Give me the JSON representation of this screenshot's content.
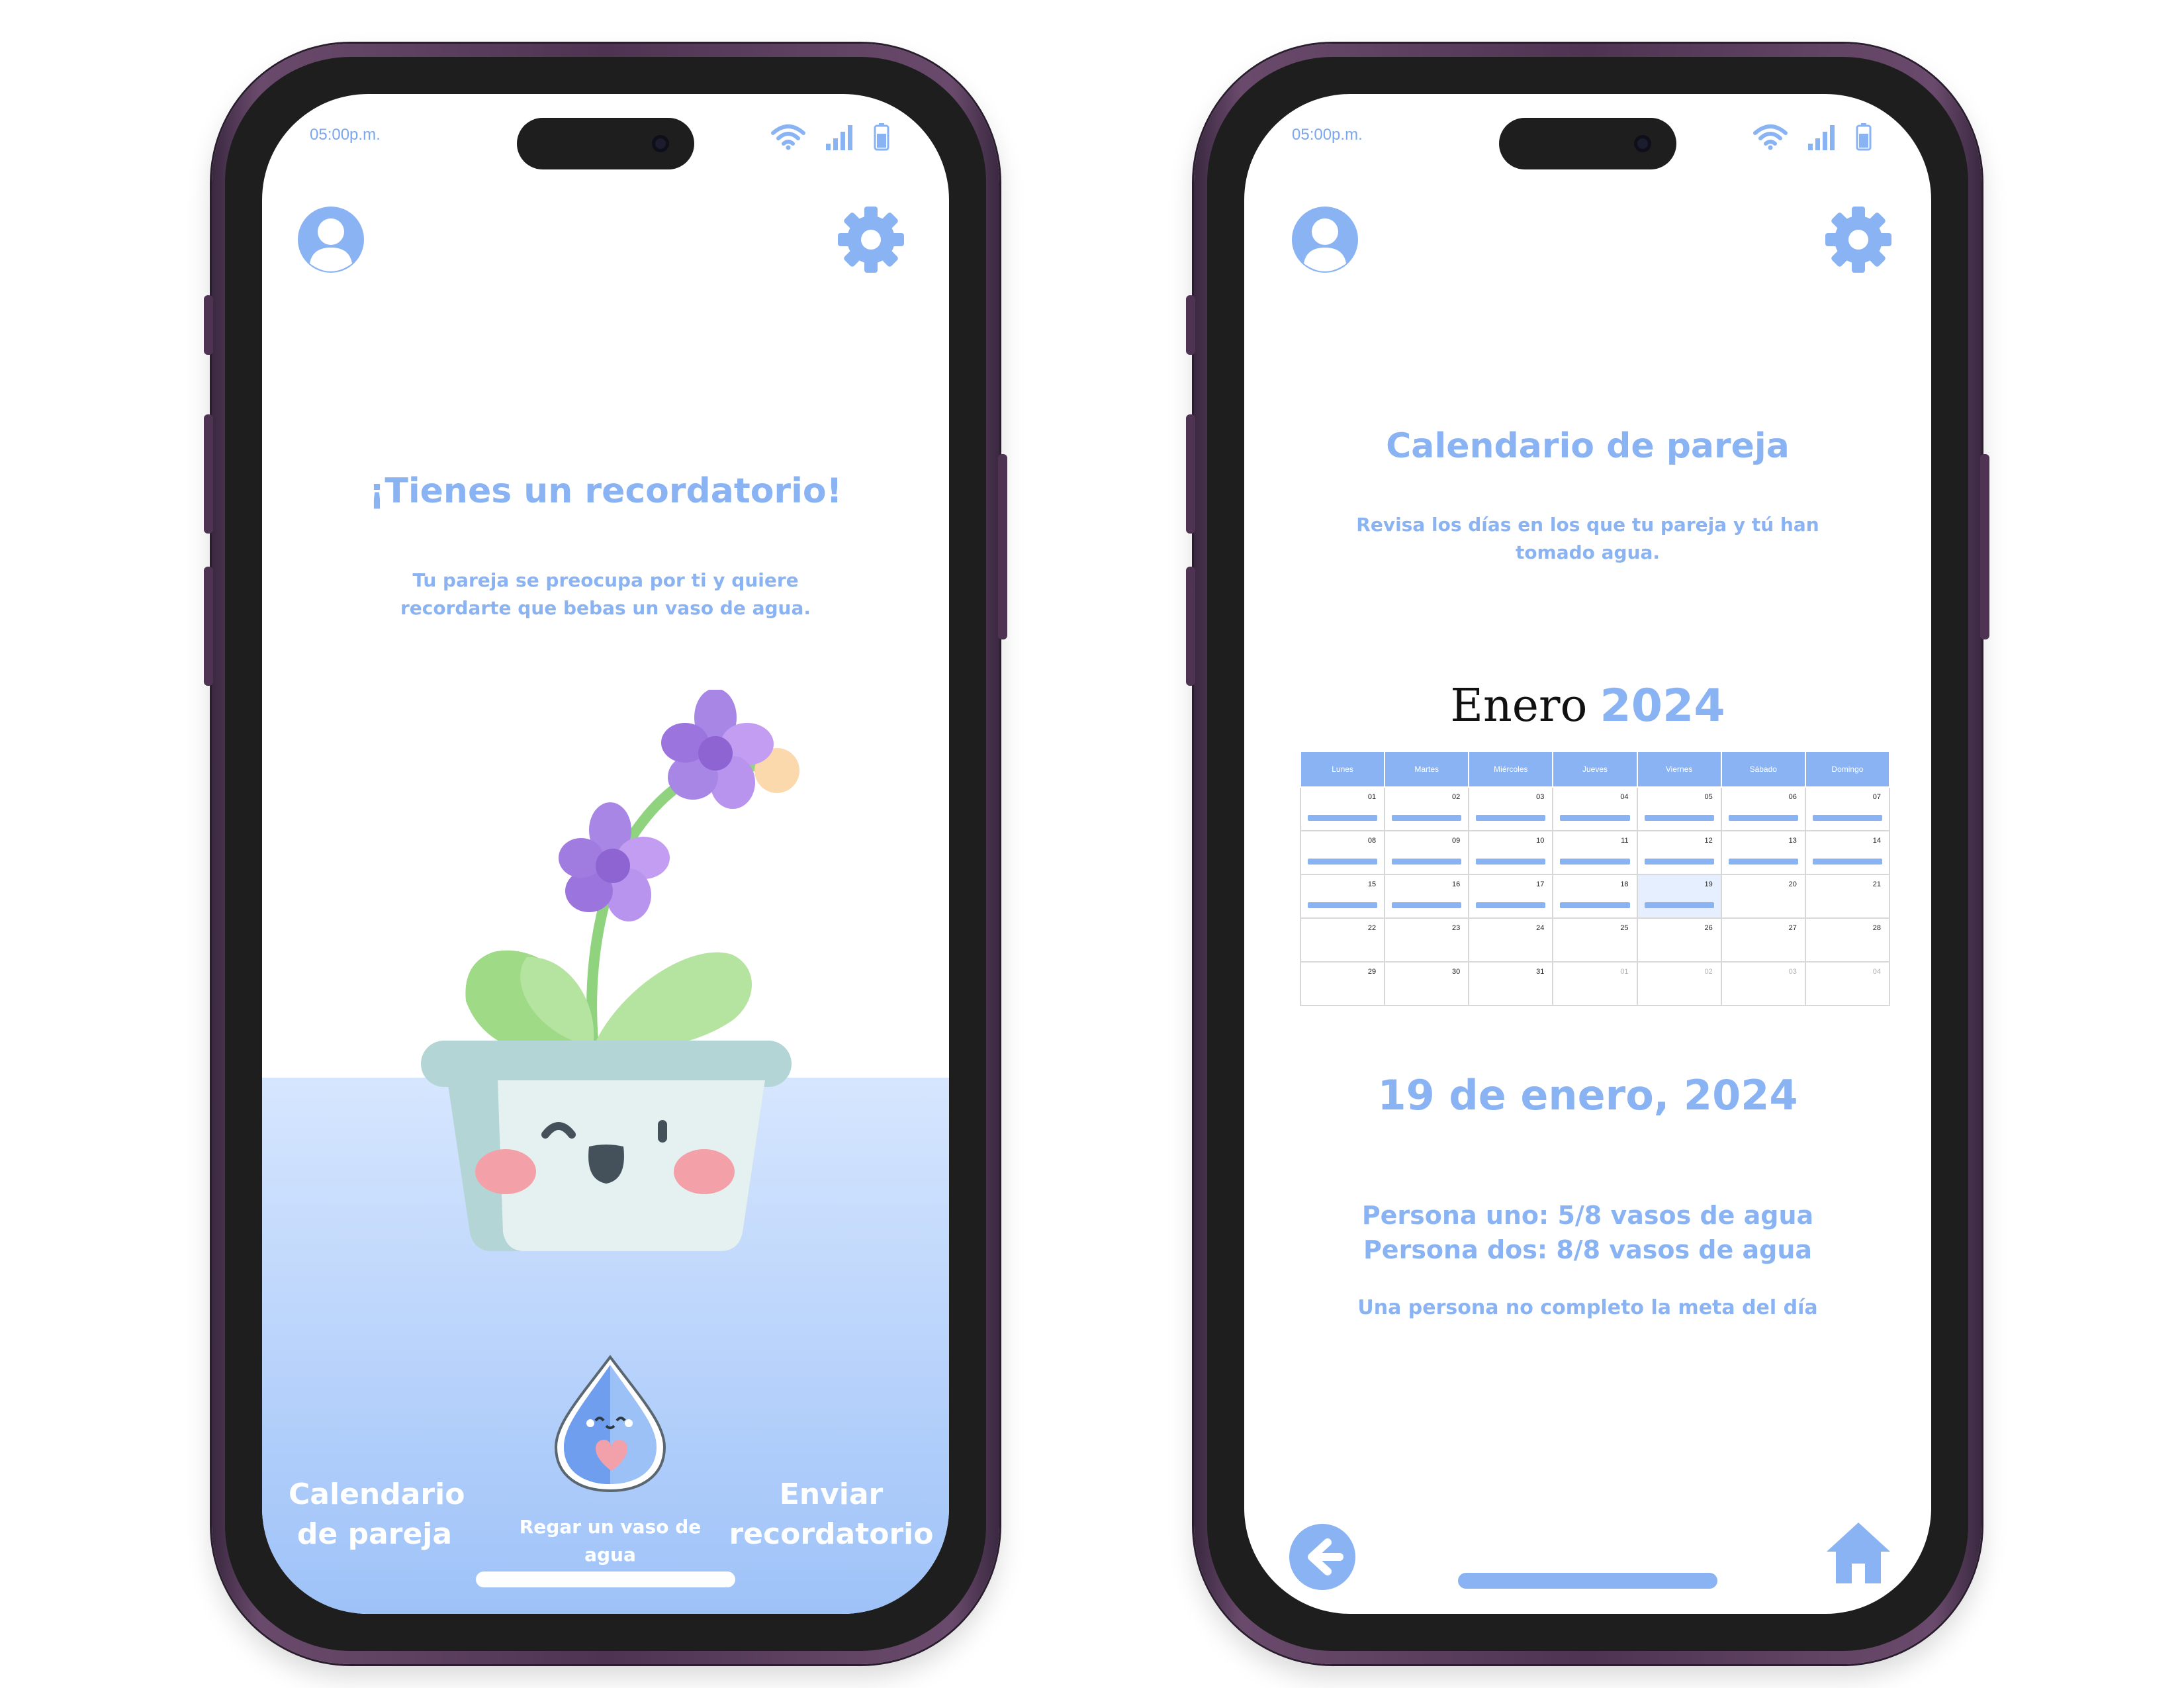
{
  "status": {
    "time": "05:00p.m."
  },
  "colors": {
    "accent": "#8ab3f3",
    "water_top": "#d6e6fe",
    "water_bottom": "#9ec2f8",
    "frame": "#4e3452"
  },
  "icons": {
    "profile": "user-circle-icon",
    "settings": "gear-icon",
    "back": "arrow-left-circle-icon",
    "home": "home-icon",
    "wifi": "wifi-icon",
    "signal": "cellular-signal-icon",
    "battery": "battery-icon"
  },
  "reminder_screen": {
    "title": "¡Tienes un recordatorio!",
    "message_line1": "Tu pareja se preocupa por ti y quiere",
    "message_line2": "recordarte que bebas un vaso de agua.",
    "nav": {
      "calendar_line1": "Calendario",
      "calendar_line2": "de pareja",
      "water_line1": "Regar un vaso de",
      "water_line2": "agua",
      "send_line1": "Enviar",
      "send_line2": "recordatorio"
    }
  },
  "calendar_screen": {
    "title": "Calendario de pareja",
    "subtitle_line1": "Revisa los días en los que tu pareja y tú han",
    "subtitle_line2": "tomado agua.",
    "month": "Enero",
    "year": "2024",
    "weekdays": [
      "Lunes",
      "Martes",
      "Miércoles",
      "Jueves",
      "Viernes",
      "Sábado",
      "Domingo"
    ],
    "weeks": [
      [
        {
          "d": "01",
          "bar": true
        },
        {
          "d": "02",
          "bar": true
        },
        {
          "d": "03",
          "bar": true
        },
        {
          "d": "04",
          "bar": true
        },
        {
          "d": "05",
          "bar": true
        },
        {
          "d": "06",
          "bar": true
        },
        {
          "d": "07",
          "bar": true
        }
      ],
      [
        {
          "d": "08",
          "bar": true
        },
        {
          "d": "09",
          "bar": true
        },
        {
          "d": "10",
          "bar": true
        },
        {
          "d": "11",
          "bar": true
        },
        {
          "d": "12",
          "bar": true
        },
        {
          "d": "13",
          "bar": true
        },
        {
          "d": "14",
          "bar": true
        }
      ],
      [
        {
          "d": "15",
          "bar": true
        },
        {
          "d": "16",
          "bar": true
        },
        {
          "d": "17",
          "bar": true
        },
        {
          "d": "18",
          "bar": true
        },
        {
          "d": "19",
          "bar": true,
          "selected": true
        },
        {
          "d": "20"
        },
        {
          "d": "21"
        }
      ],
      [
        {
          "d": "22"
        },
        {
          "d": "23"
        },
        {
          "d": "24"
        },
        {
          "d": "25"
        },
        {
          "d": "26"
        },
        {
          "d": "27"
        },
        {
          "d": "28"
        }
      ],
      [
        {
          "d": "29"
        },
        {
          "d": "30"
        },
        {
          "d": "31"
        },
        {
          "d": "01",
          "other": true
        },
        {
          "d": "02",
          "other": true
        },
        {
          "d": "03",
          "other": true
        },
        {
          "d": "04",
          "other": true
        }
      ]
    ],
    "selected_date": "19 de enero, 2024",
    "person_one": "Persona uno: 5/8 vasos de agua",
    "person_two": "Persona dos: 8/8 vasos de agua",
    "goal_status": "Una persona no completo la meta del día"
  }
}
